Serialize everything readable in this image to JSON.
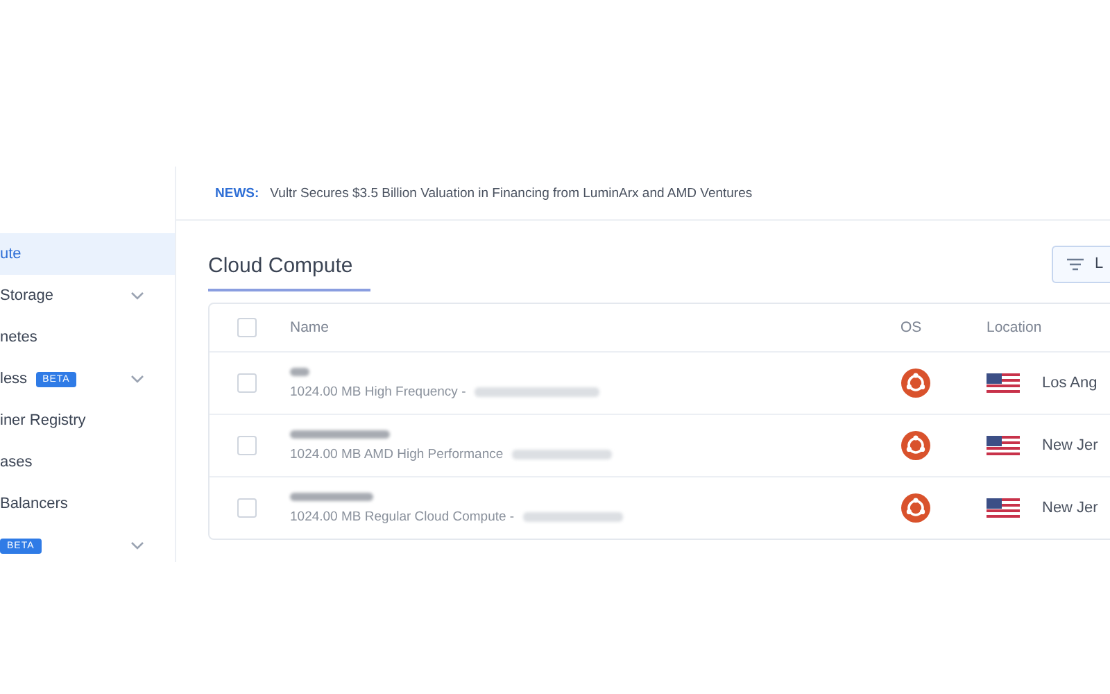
{
  "sidebar": {
    "items": [
      {
        "label": "ute",
        "selected": true,
        "expandable": false
      },
      {
        "label": "Storage",
        "selected": false,
        "expandable": true
      },
      {
        "label": "netes",
        "selected": false,
        "expandable": false
      },
      {
        "label": "less",
        "badge": "BETA",
        "selected": false,
        "expandable": true
      },
      {
        "label": "iner Registry",
        "selected": false,
        "expandable": false
      },
      {
        "label": "ases",
        "selected": false,
        "expandable": false
      },
      {
        "label": "Balancers",
        "selected": false,
        "expandable": false
      },
      {
        "badge": "BETA",
        "selected": false,
        "expandable": true
      }
    ]
  },
  "news": {
    "label": "NEWS:",
    "text": "Vultr Secures $3.5 Billion Valuation in Financing from LuminArx and AMD Ventures"
  },
  "page": {
    "title": "Cloud Compute",
    "button": "L"
  },
  "table": {
    "all_checked": false,
    "columns": [
      "Name",
      "OS",
      "Location"
    ],
    "rows": [
      {
        "checked": false,
        "plan": "1024.00 MB High Frequency -",
        "location": "Los Ang"
      },
      {
        "checked": false,
        "plan": "1024.00 MB AMD High Performance",
        "location": "New Jer"
      },
      {
        "checked": false,
        "plan": "1024.00 MB Regular Cloud Compute -",
        "location": "New Jer"
      }
    ]
  }
}
